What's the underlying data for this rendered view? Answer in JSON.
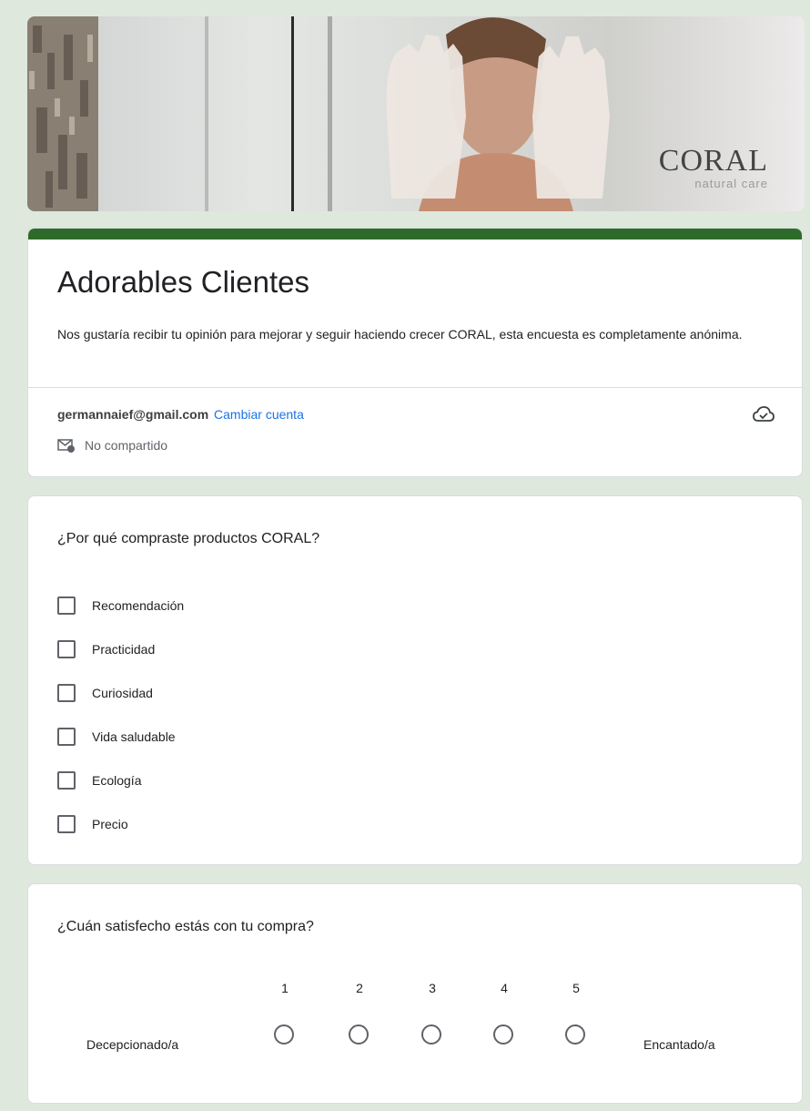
{
  "banner": {
    "brand_name": "CORAL",
    "brand_tagline": "natural care"
  },
  "form": {
    "title": "Adorables Clientes",
    "description": "Nos gustaría recibir tu opinión para mejorar y seguir haciendo crecer CORAL, esta encuesta es completamente anónima.",
    "account_email": "germannaief@gmail.com",
    "switch_account": "Cambiar cuenta",
    "not_shared": "No compartido",
    "accent_color": "#2e6b2a"
  },
  "q1": {
    "title": "¿Por qué compraste productos CORAL?",
    "options": [
      "Recomendación",
      "Practicidad",
      "Curiosidad",
      "Vida saludable",
      "Ecología",
      "Precio"
    ]
  },
  "q2": {
    "title": "¿Cuán satisfecho estás con tu compra?",
    "scale": [
      "1",
      "2",
      "3",
      "4",
      "5"
    ],
    "low_label": "Decepcionado/a",
    "high_label": "Encantado/a"
  }
}
